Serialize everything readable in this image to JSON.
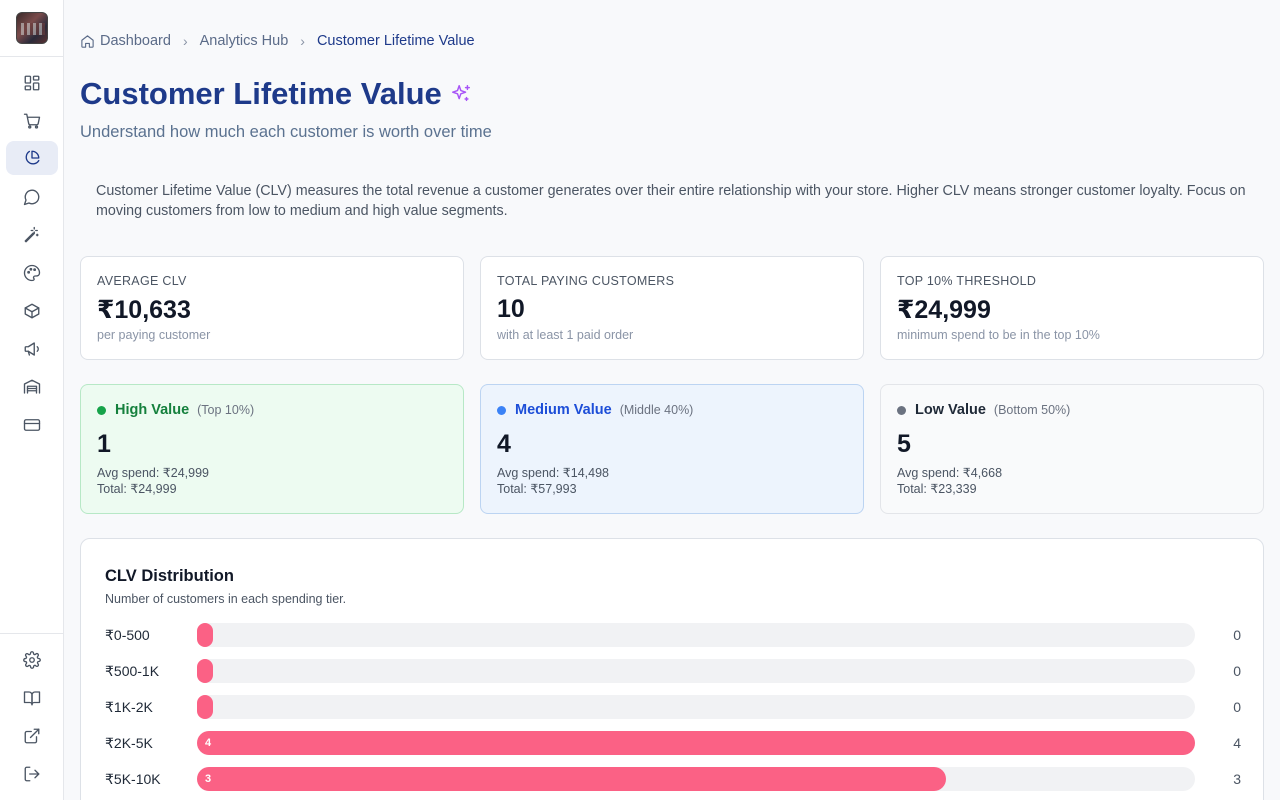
{
  "sidebar": {
    "items": [
      {
        "icon": "dashboard-icon"
      },
      {
        "icon": "cart-icon"
      },
      {
        "icon": "pie-chart-icon",
        "active": true
      },
      {
        "icon": "chat-icon"
      },
      {
        "icon": "magic-wand-icon"
      },
      {
        "icon": "palette-icon"
      },
      {
        "icon": "box-icon"
      },
      {
        "icon": "megaphone-icon"
      },
      {
        "icon": "warehouse-icon"
      },
      {
        "icon": "credit-card-icon"
      }
    ],
    "footer": [
      {
        "icon": "gear-icon"
      },
      {
        "icon": "book-icon"
      },
      {
        "icon": "external-link-icon"
      },
      {
        "icon": "logout-icon"
      }
    ]
  },
  "breadcrumb": {
    "home": "Dashboard",
    "section": "Analytics Hub",
    "current": "Customer Lifetime Value"
  },
  "page": {
    "title": "Customer Lifetime Value",
    "subtitle": "Understand how much each customer is worth over time",
    "intro": "Customer Lifetime Value (CLV) measures the total revenue a customer generates over their entire relationship with your store. Higher CLV means stronger customer loyalty. Focus on moving customers from low to medium and high value segments."
  },
  "stats": [
    {
      "label": "AVERAGE CLV",
      "value": "₹10,633",
      "note": "per paying customer"
    },
    {
      "label": "TOTAL PAYING CUSTOMERS",
      "value": "10",
      "note": "with at least 1 paid order"
    },
    {
      "label": "TOP 10% THRESHOLD",
      "value": "₹24,999",
      "note": "minimum spend to be in the top 10%"
    }
  ],
  "segments": [
    {
      "name": "High Value",
      "range": "(Top 10%)",
      "count": "1",
      "avg": "Avg spend: ₹24,999",
      "total": "Total: ₹24,999",
      "color": "#16a34a",
      "text_color": "#15803d",
      "bg": "#edfbf1",
      "border": "#b7e8c6"
    },
    {
      "name": "Medium Value",
      "range": "(Middle 40%)",
      "count": "4",
      "avg": "Avg spend: ₹14,498",
      "total": "Total: ₹57,993",
      "color": "#3b82f6",
      "text_color": "#1d4ed8",
      "bg": "#edf4fd",
      "border": "#bcd4f2"
    },
    {
      "name": "Low Value",
      "range": "(Bottom 50%)",
      "count": "5",
      "avg": "Avg spend: ₹4,668",
      "total": "Total: ₹23,339",
      "color": "#6b7280",
      "text_color": "#1f2937",
      "bg": "#f9fafb",
      "border": "#e3e5e9"
    }
  ],
  "distribution": {
    "title": "CLV Distribution",
    "subtitle": "Number of customers in each spending tier.",
    "bar_color": "#fb6185"
  },
  "chart_data": {
    "type": "bar",
    "orientation": "horizontal",
    "categories": [
      "₹0-500",
      "₹500-1K",
      "₹1K-2K",
      "₹2K-5K",
      "₹5K-10K"
    ],
    "values": [
      0,
      0,
      0,
      4,
      3
    ],
    "xlim": [
      0,
      4
    ]
  }
}
